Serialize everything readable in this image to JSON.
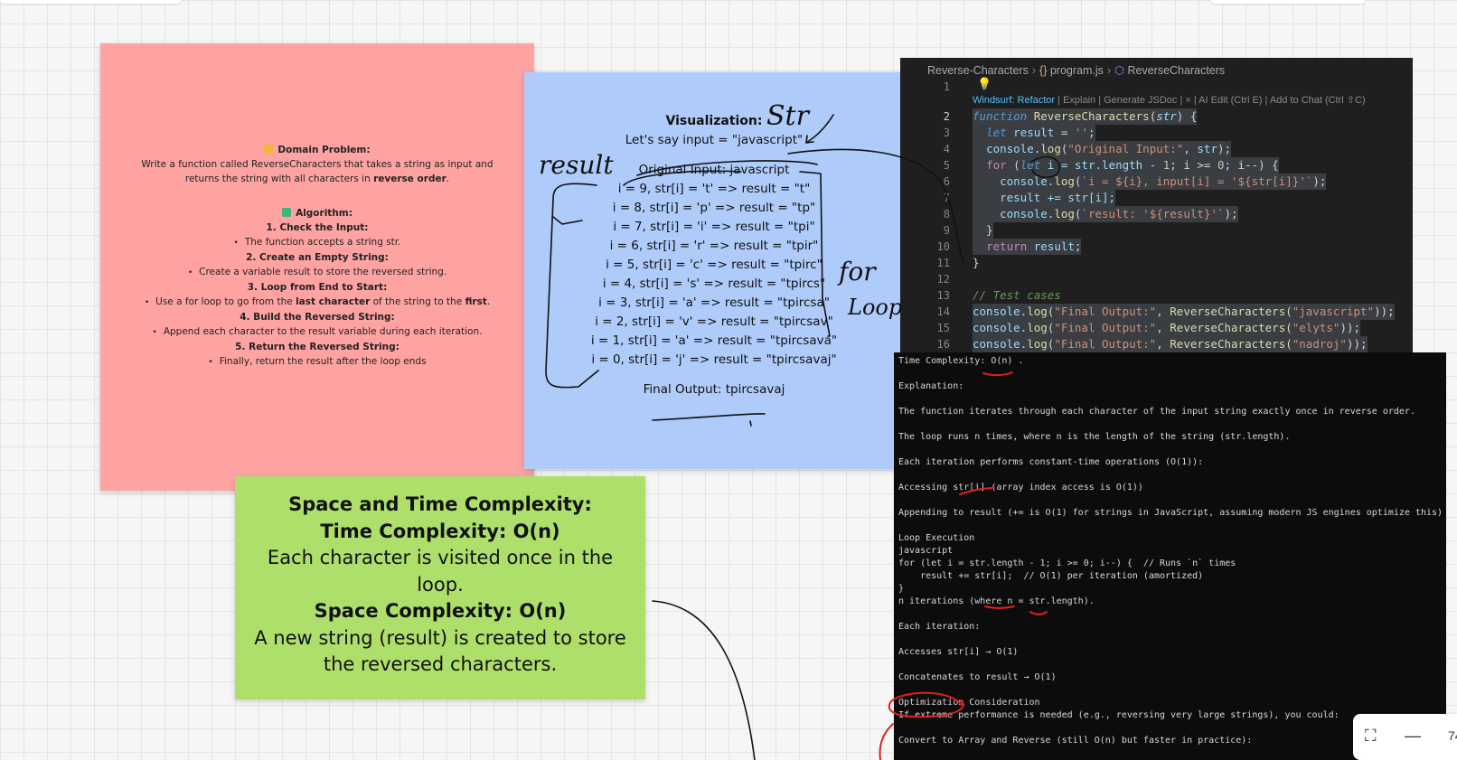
{
  "pink_note": {
    "domain_title": "Domain Problem:",
    "domain_text_1": "Write a function called ReverseCharacters that takes a string as input and",
    "domain_text_2a": "returns the string with all characters in ",
    "domain_text_2b": "reverse order",
    "domain_text_2c": ".",
    "algorithm_title": "Algorithm:",
    "step1": "1. Check the Input:",
    "step1_detail": "The function accepts a string str.",
    "step2": "2. Create an Empty String:",
    "step2_detail": "Create a variable result to store the reversed string.",
    "step3": "3. Loop from End to Start:",
    "step3_detail_a": "Use a for loop to go from the ",
    "step3_detail_b": "last character",
    "step3_detail_c": " of the string to the ",
    "step3_detail_d": "first",
    "step3_detail_e": ".",
    "step4": "4. Build the Reversed String:",
    "step4_detail": "Append each character to the result variable during each iteration.",
    "step5": "5. Return the Reversed String:",
    "step5_detail": "Finally, return the result after the loop ends",
    "colors": {
      "note": "#fea3a2",
      "domain_icon": "#f4b63a",
      "algorithm_icon": "#3fb67a"
    }
  },
  "blue_note": {
    "title": "Visualization:",
    "intro": "Let's say input = \"javascript\"",
    "original": "Original Input: javascript",
    "iterations": [
      "i = 9, str[i] = 't' => result = \"t\"",
      "i = 8, str[i] = 'p' => result = \"tp\"",
      "i = 7, str[i] = 'i' => result = \"tpi\"",
      "i = 6, str[i] = 'r' => result = \"tpir\"",
      "i = 5, str[i] = 'c' => result = \"tpirc\"",
      "i = 4, str[i] = 's' => result = \"tpircs\"",
      "i = 3, str[i] = 'a' => result = \"tpircsa\"",
      "i = 2, str[i] = 'v' => result = \"tpircsav\"",
      "i = 1, str[i] = 'a' => result = \"tpircsava\"",
      "i = 0, str[i] = 'j' => result = \"tpircsavaj\""
    ],
    "final": "Final Output: tpircsavaj",
    "colors": {
      "note": "#aecbfa"
    }
  },
  "green_note": {
    "heading": "Space and Time Complexity:",
    "time_heading": "Time Complexity: O(n)",
    "time_text": "Each character is visited once in the loop.",
    "space_heading": "Space Complexity: O(n)",
    "space_text": "A new string (result) is created to store the reversed characters.",
    "colors": {
      "note": "#aedf6b"
    }
  },
  "editor": {
    "breadcrumb": {
      "folder": "Reverse-Characters",
      "file": "program.js",
      "symbol": "ReverseCharacters"
    },
    "codelens": {
      "windsurf": "Windsurf: Refactor",
      "rest": " | Explain | Generate JSDoc | × | AI Edit (Ctrl E) | Add to Chat (Ctrl ⇧C)"
    },
    "line_numbers": [
      "1",
      "2",
      "3",
      "4",
      "5",
      "6",
      "7",
      "8",
      "9",
      "10",
      "11",
      "12",
      "13",
      "14",
      "15",
      "16"
    ],
    "code": {
      "l2_kw": "function",
      "l2_fn": " ReverseCharacters",
      "l2_prm": "str",
      "l3_kw": "let",
      "l3_var": " result",
      "l3_str": "''",
      "l4_var": "console",
      "l4_fn": "log",
      "l4_str": "\"Original Input:\"",
      "l4_arg": "str",
      "l5_ctl": "for",
      "l5_kw": "let",
      "l5_a": " i = str.",
      "l5_prop": "length",
      "l5_num1": "1",
      "l5_num2": "0",
      "l6_a": "console",
      "l6_fn": "log",
      "l6_str1": "`i = ${i}, input[i] = '${str[i]}'`",
      "l7_a": "result += str[i];",
      "l8_a": "console",
      "l8_fn": "log",
      "l8_str": "`result: '${result}'`",
      "l10_ctl": "return",
      "l10_var": " result",
      "l13_cm": "// Test cases",
      "l14_arg": "\"javascript\"",
      "l15_arg": "\"elyts\"",
      "l16_arg": "\"nadroj\"",
      "final_label": "\"Final Output:\"",
      "fn_name": "ReverseCharacters"
    }
  },
  "terminal": {
    "lines": [
      "Time Complexity: O(n) .",
      "",
      "Explanation:",
      "",
      "The function iterates through each character of the input string exactly once in reverse order.",
      "",
      "The loop runs n times, where n is the length of the string (str.length).",
      "",
      "Each iteration performs constant-time operations (O(1)):",
      "",
      "Accessing str[i] (array index access is O(1))",
      "",
      "Appending to result (+= is O(1) for strings in JavaScript, assuming modern JS engines optimize this)",
      "",
      "Loop Execution",
      "javascript",
      "for (let i = str.length - 1; i >= 0; i--) {  // Runs `n` times",
      "    result += str[i];  // O(1) per iteration (amortized)",
      "}",
      "n iterations (where n = str.length).",
      "",
      "Each iteration:",
      "",
      "Accesses str[i] → O(1)",
      "",
      "Concatenates to result → O(1)",
      "",
      "Optimization Consideration",
      "If extreme performance is needed (e.g., reversing very large strings), you could:",
      "",
      "Convert to Array and Reverse (still O(n) but faster in practice):"
    ]
  },
  "handwriting": {
    "str_label": "Str",
    "result_label": "result",
    "for_label": "for",
    "loop_label": "Loop",
    "ink_color": "#111111",
    "annotation_color": "#e02020"
  },
  "zoom": {
    "value": "74"
  }
}
